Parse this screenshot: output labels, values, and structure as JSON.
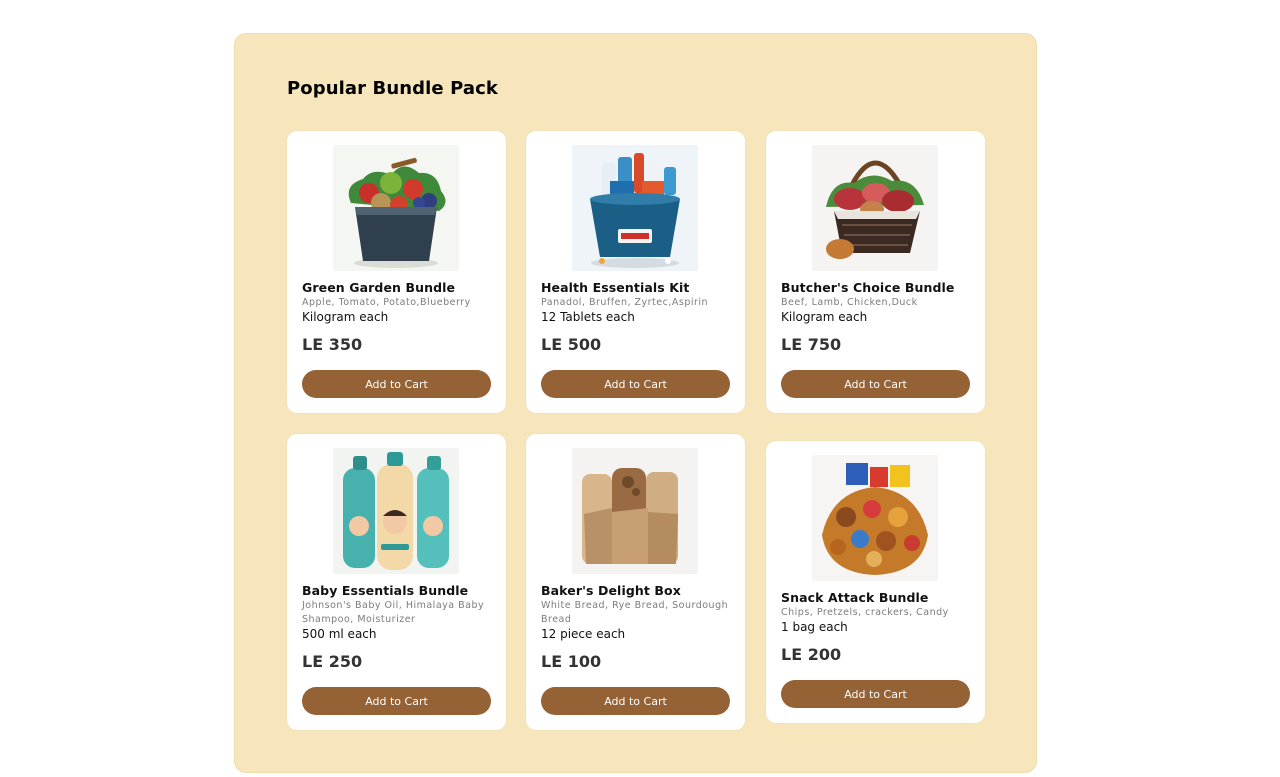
{
  "section": {
    "title": "Popular Bundle Pack"
  },
  "colors": {
    "panel_bg": "#f7e6bb",
    "button_bg": "#946235",
    "button_text": "#ffffff"
  },
  "products": [
    {
      "name": "Green Garden Bundle",
      "description": "Apple, Tomato, Potato,Blueberry",
      "unit": "Kilogram each",
      "price": "LE 350",
      "button": "Add to Cart",
      "image_icon": "fruit-basket-icon"
    },
    {
      "name": "Health Essentials Kit",
      "description": "Panadol, Bruffen, Zyrtec,Aspirin",
      "unit": "12 Tablets each",
      "price": "LE 500",
      "button": "Add to Cart",
      "image_icon": "medicine-bucket-icon"
    },
    {
      "name": "Butcher's Choice Bundle",
      "description": "Beef, Lamb, Chicken,Duck",
      "unit": "Kilogram each",
      "price": "LE 750",
      "button": "Add to Cart",
      "image_icon": "meat-basket-icon"
    },
    {
      "name": "Baby Essentials Bundle",
      "description": "Johnson's Baby Oil, Himalaya Baby Shampoo, Moisturizer",
      "unit": "500 ml each",
      "price": "LE 250",
      "button": "Add to Cart",
      "image_icon": "baby-products-icon"
    },
    {
      "name": "Baker's Delight Box",
      "description": "White Bread, Rye Bread, Sourdough Bread",
      "unit": "12 piece each",
      "price": "LE 100",
      "button": "Add to Cart",
      "image_icon": "bread-bags-icon"
    },
    {
      "name": "Snack Attack Bundle",
      "description": "Chips, Pretzels, crackers, Candy",
      "unit": "1 bag each",
      "price": "LE 200",
      "button": "Add to Cart",
      "image_icon": "snacks-pile-icon"
    }
  ]
}
